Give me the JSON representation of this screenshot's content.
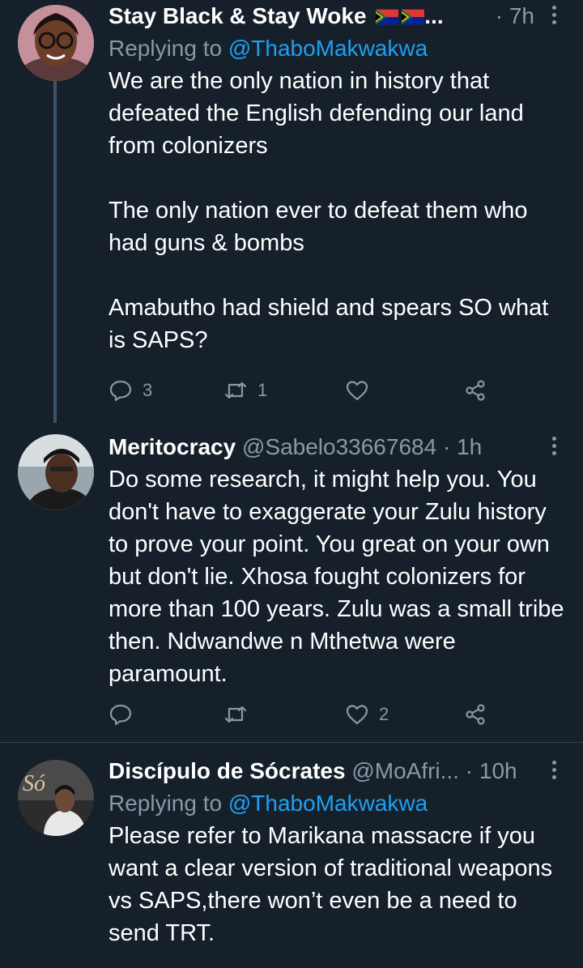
{
  "tweets": [
    {
      "name": "Stay Black & Stay Woke",
      "name_suffix": "...",
      "handle": "",
      "time": "· 7h",
      "reply_label": "Replying to",
      "reply_to": "@ThaboMakwakwa",
      "text": "We are the only nation in history that defeated the English defending our land from colonizers\n\nThe only nation ever to defeat them who had guns & bombs\n\nAmabutho had shield and spears SO what is SAPS?",
      "replies": "3",
      "retweets": "1",
      "likes": ""
    },
    {
      "name": "Meritocracy",
      "handle": "@Sabelo33667684",
      "time": "· 1h",
      "text": "Do some research, it might help you. You don't have to exaggerate your Zulu history to prove your point. You great on your own but don't lie. Xhosa fought colonizers for more than 100 years. Zulu was a small tribe then. Ndwandwe n Mthetwa were paramount.",
      "replies": "",
      "retweets": "",
      "likes": "2"
    },
    {
      "name": "Discípulo de Sócrates",
      "handle": "@MoAfri...",
      "time": "· 10h",
      "reply_label": "Replying to",
      "reply_to": "@ThaboMakwakwa",
      "text": "Please refer to Marikana massacre if you want a clear version of traditional weapons vs SAPS,there won’t even be a need to send TRT."
    }
  ],
  "icons": {
    "reply": "reply-icon",
    "retweet": "retweet-icon",
    "like": "heart-icon",
    "share": "share-icon",
    "more": "more-icon",
    "flag": "south-africa-flag-icon"
  },
  "colors": {
    "background": "#15202b",
    "secondary_text": "#8899a6",
    "accent": "#1da1f2",
    "divider": "#38444d"
  }
}
